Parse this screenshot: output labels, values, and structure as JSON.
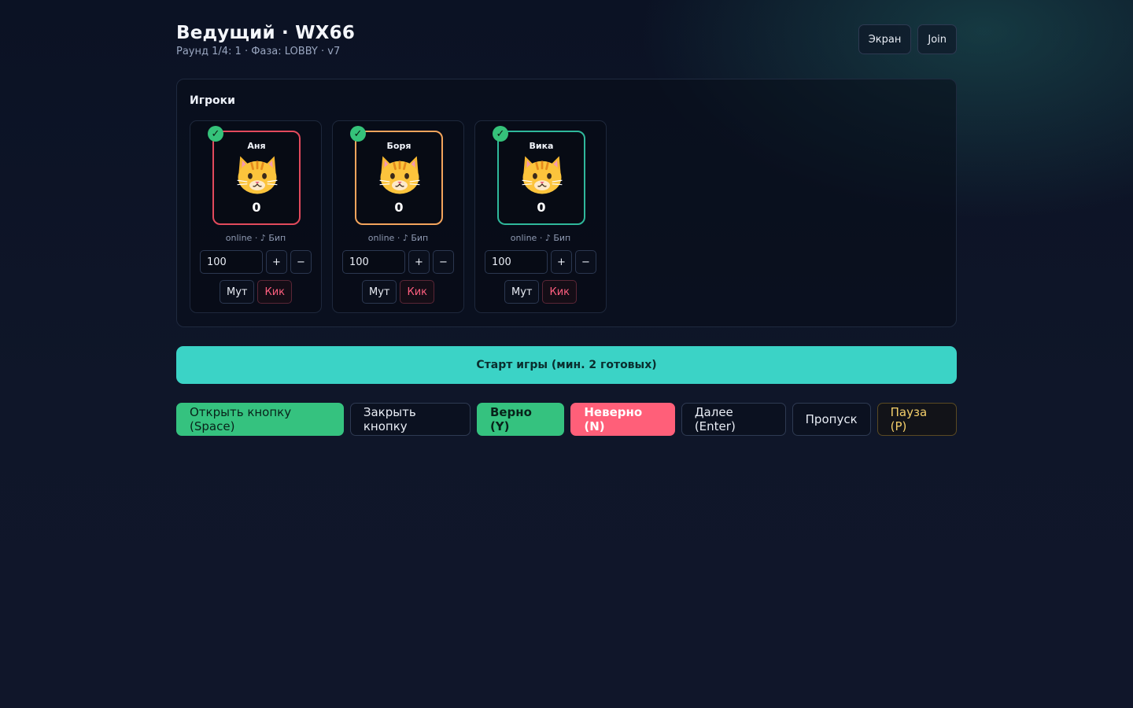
{
  "header": {
    "title": "Ведущий · WX66",
    "subtitle": "Раунд 1/4: 1 · Фаза: LOBBY · v7",
    "screen_button": "Экран",
    "join_button": "Join"
  },
  "players_panel": {
    "title": "Игроки",
    "players": [
      {
        "name": "Аня",
        "score": "0",
        "status": "online",
        "separator": "·",
        "sound": "♪ Бип",
        "stake": "100",
        "plus_label": "+",
        "minus_label": "−",
        "mute_label": "Мут",
        "kick_label": "Кик",
        "ready_mark": "✓",
        "border_color": "#e24a5c",
        "ready": true
      },
      {
        "name": "Боря",
        "score": "0",
        "status": "online",
        "separator": "·",
        "sound": "♪ Бип",
        "stake": "100",
        "plus_label": "+",
        "minus_label": "−",
        "mute_label": "Мут",
        "kick_label": "Кик",
        "ready_mark": "✓",
        "border_color": "#f3a45c",
        "ready": true
      },
      {
        "name": "Вика",
        "score": "0",
        "status": "online",
        "separator": "·",
        "sound": "♪ Бип",
        "stake": "100",
        "plus_label": "+",
        "minus_label": "−",
        "mute_label": "Мут",
        "kick_label": "Кик",
        "ready_mark": "✓",
        "border_color": "#2fb89b",
        "ready": true
      }
    ]
  },
  "start_button": "Старт игры (мин. 2 готовых)",
  "controls": {
    "open": "Открыть кнопку (Space)",
    "close": "Закрыть кнопку",
    "correct": "Верно (Y)",
    "wrong": "Неверно (N)",
    "next": "Далее (Enter)",
    "skip": "Пропуск",
    "pause": "Пауза (P)"
  },
  "colors": {
    "accent": "#3bd3c6",
    "success": "#35c27f",
    "danger": "#ff5f79",
    "warning": "#f4cf6a"
  },
  "icons": {
    "avatar": "cat-face-icon",
    "ready": "checkmark-icon"
  }
}
